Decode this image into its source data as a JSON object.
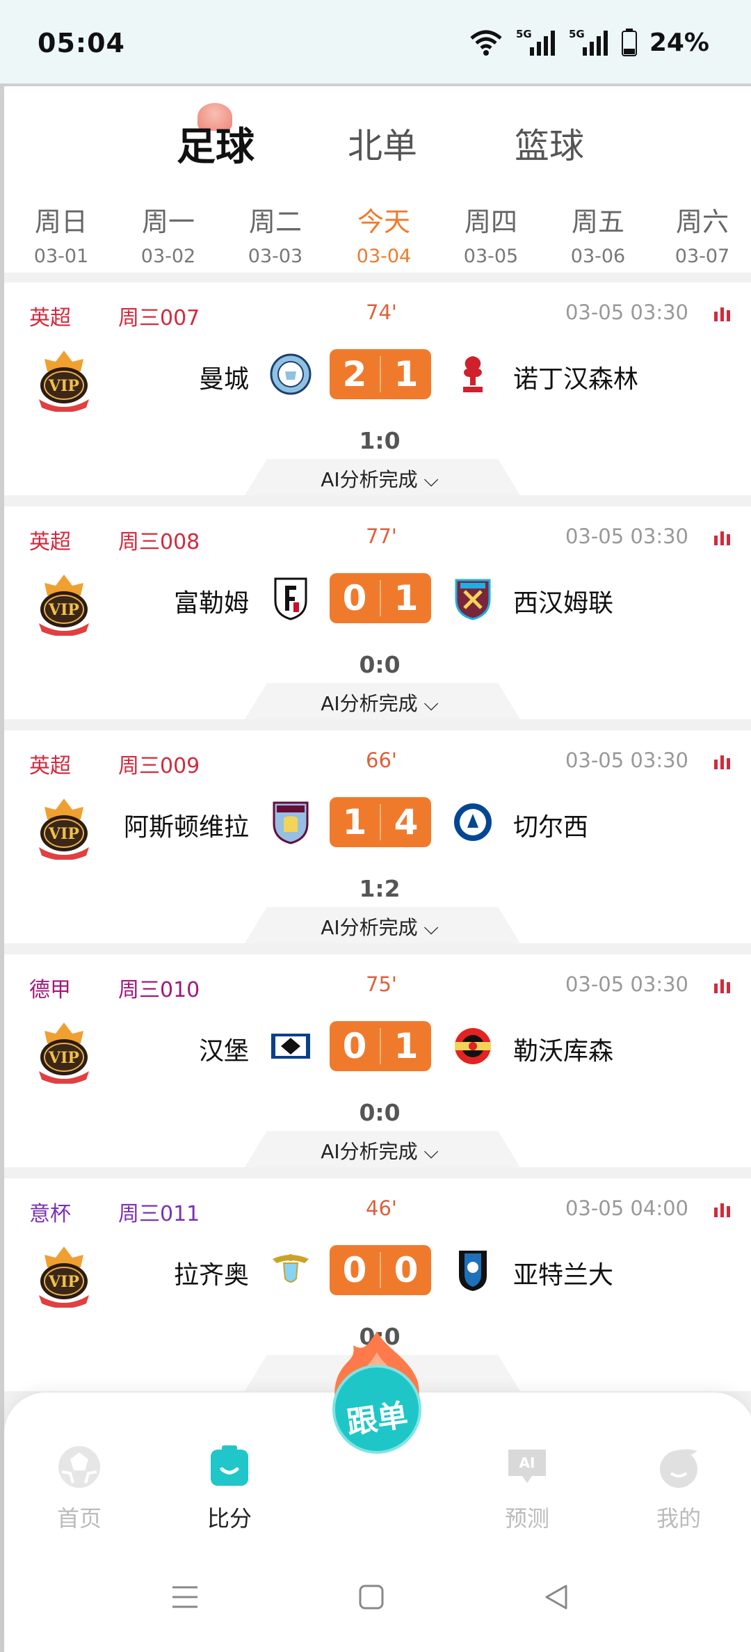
{
  "status_bar": {
    "time": "05:04",
    "battery": "24%",
    "network_1": "5G",
    "network_2": "5G"
  },
  "sport_tabs": [
    "足球",
    "北单",
    "篮球"
  ],
  "dates": [
    {
      "day": "周日",
      "date": "03-01"
    },
    {
      "day": "周一",
      "date": "03-02"
    },
    {
      "day": "周二",
      "date": "03-03"
    },
    {
      "day": "今天",
      "date": "03-04"
    },
    {
      "day": "周四",
      "date": "03-05"
    },
    {
      "day": "周五",
      "date": "03-06"
    },
    {
      "day": "周六",
      "date": "03-07"
    }
  ],
  "colors": {
    "accent": "#f07a2c",
    "epl": "#d22a3c",
    "bundesliga": "#a3177a",
    "coppa": "#7a32b3"
  },
  "matches": [
    {
      "league": "英超",
      "code": "周三007",
      "minute": "74'",
      "kickoff": "03-05 03:30",
      "home": "曼城",
      "away": "诺丁汉森林",
      "home_score": "2",
      "away_score": "1",
      "half": "1:0",
      "ai": "AI分析完成",
      "home_crest": "man-city-crest-icon",
      "away_crest": "nottingham-forest-crest-icon"
    },
    {
      "league": "英超",
      "code": "周三008",
      "minute": "77'",
      "kickoff": "03-05 03:30",
      "home": "富勒姆",
      "away": "西汉姆联",
      "home_score": "0",
      "away_score": "1",
      "half": "0:0",
      "ai": "AI分析完成",
      "home_crest": "fulham-crest-icon",
      "away_crest": "west-ham-crest-icon"
    },
    {
      "league": "英超",
      "code": "周三009",
      "minute": "66'",
      "kickoff": "03-05 03:30",
      "home": "阿斯顿维拉",
      "away": "切尔西",
      "home_score": "1",
      "away_score": "4",
      "half": "1:2",
      "ai": "AI分析完成",
      "home_crest": "aston-villa-crest-icon",
      "away_crest": "chelsea-crest-icon"
    },
    {
      "league": "德甲",
      "code": "周三010",
      "minute": "75'",
      "kickoff": "03-05 03:30",
      "home": "汉堡",
      "away": "勒沃库森",
      "home_score": "0",
      "away_score": "1",
      "half": "0:0",
      "ai": "AI分析完成",
      "home_crest": "hamburg-crest-icon",
      "away_crest": "leverkusen-crest-icon"
    },
    {
      "league": "意杯",
      "code": "周三011",
      "minute": "46'",
      "kickoff": "03-05 04:00",
      "home": "拉齐奥",
      "away": "亚特兰大",
      "home_score": "0",
      "away_score": "0",
      "half": "0:0",
      "ai": "",
      "home_crest": "lazio-crest-icon",
      "away_crest": "atalanta-crest-icon"
    }
  ],
  "vip_label": "VIP",
  "follow_button": "跟单",
  "bottom_nav": [
    "首页",
    "比分",
    "",
    "预测",
    "我的"
  ],
  "ai_badge": "AI"
}
